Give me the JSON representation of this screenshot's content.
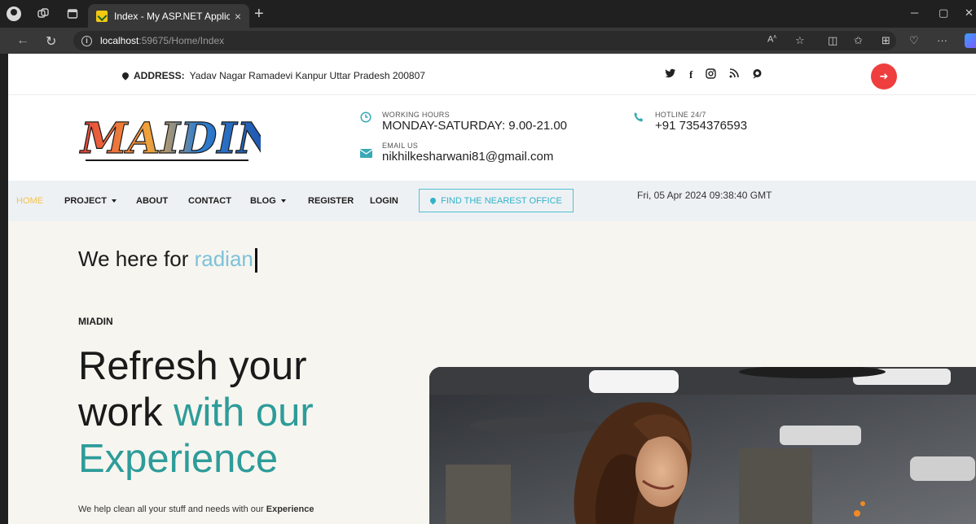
{
  "browser": {
    "tab_title": "Index - My ASP.NET Application",
    "tab_close": "×",
    "new_tab": "+",
    "url_host": "localhost",
    "url_path": ":59675/Home/Index"
  },
  "topbar": {
    "address_label": "ADDRESS:",
    "address_value": "Yadav Nagar Ramadevi Kanpur Uttar Pradesh 200807",
    "social_icons": [
      "twitter-icon",
      "facebook-icon",
      "instagram-icon",
      "rss-icon",
      "chat-icon"
    ]
  },
  "header": {
    "logo_text": "MAIDIN",
    "working_hours_label": "WORKING HOURS",
    "working_hours_value": "MONDAY-SATURDAY: 9.00-21.00",
    "email_label": "EMAIL US",
    "email_value": "nikhilkesharwani81@gmail.com",
    "hotline_label": "HOTLINE 24/7",
    "hotline_value": "+91 7354376593"
  },
  "nav": {
    "items": [
      "HOME",
      "PROJECT",
      "ABOUT",
      "CONTACT",
      "BLOG",
      "REGISTER",
      "LOGIN"
    ],
    "office_button": "FIND THE NEAREST OFFICE",
    "datetime": "Fri, 05 Apr 2024 09:38:40 GMT"
  },
  "hero": {
    "typing_prefix": "We here for",
    "typing_word": "radian",
    "kicker": "MIADIN",
    "title_line1": "Refresh your",
    "title_line2_a": "work",
    "title_line2_b": "with our",
    "title_line3": "Experience",
    "subtitle_prefix": "We help clean all your stuff and needs with our",
    "subtitle_bold": "Experience"
  },
  "colors": {
    "accent_teal": "#2d9c9a",
    "active_nav": "#f4c24b",
    "logout_red": "#ef3e3e",
    "typing_highlight": "#7cc2da"
  }
}
